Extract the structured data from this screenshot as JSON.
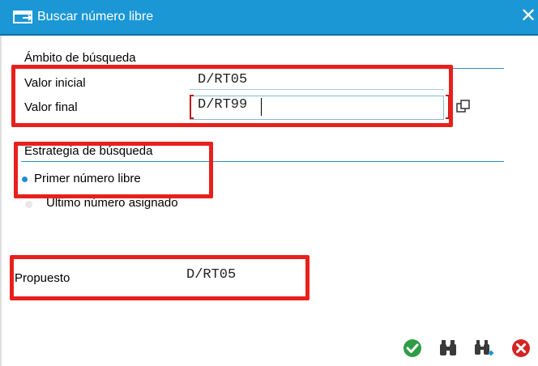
{
  "window": {
    "title": "Buscar número libre"
  },
  "search_scope": {
    "heading": "Ámbito de búsqueda",
    "initial_label": "Valor inicial",
    "initial_value": "D/RT05",
    "final_label": "Valor final",
    "final_value": "D/RT99"
  },
  "strategy": {
    "heading": "Estrategia de búsqueda",
    "options": [
      "Primer número libre",
      "Último número asignado"
    ],
    "selected": "Primer número libre"
  },
  "proposal": {
    "label": "Propuesto",
    "value": "D/RT05"
  },
  "toolbar": {
    "icons": [
      "check-icon",
      "binoculars-icon",
      "binoculars-plus-icon",
      "cancel-icon"
    ]
  },
  "colors": {
    "title_bar": "#1b97d6",
    "highlight": "#e8201c",
    "ok": "#2e9d46",
    "cancel": "#d42424"
  }
}
